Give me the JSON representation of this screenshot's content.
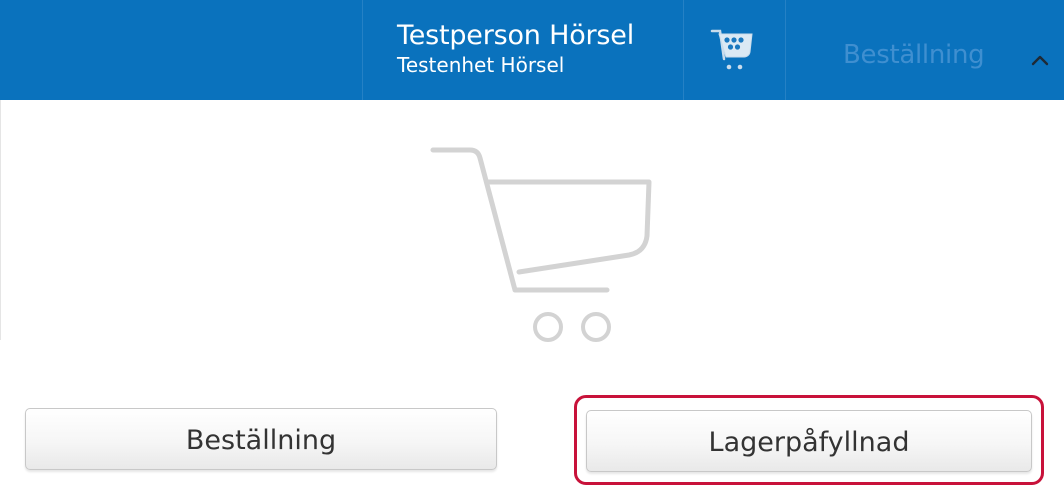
{
  "header": {
    "user_name": "Testperson Hörsel",
    "unit_name": "Testenhet Hörsel",
    "order_link": "Beställning",
    "cart_icon": "shopping-cart-icon",
    "chevron_icon": "chevron-up-icon"
  },
  "main": {
    "empty_cart_icon": "empty-shopping-cart-icon",
    "order_button": "Beställning",
    "restock_button": "Lagerpåfyllnad"
  },
  "colors": {
    "header_background": "#0a72bd",
    "header_text": "#ffffff",
    "header_link": "#3f8fd0",
    "highlight": "#c8123a",
    "cart_illustration": "#d3d3d3"
  }
}
